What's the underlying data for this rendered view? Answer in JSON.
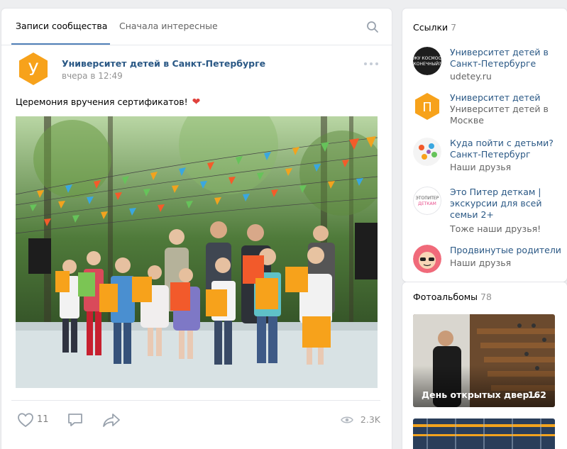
{
  "tabs": {
    "community_posts": "Записи сообщества",
    "interesting_first": "Сначала интересные"
  },
  "post": {
    "author": "Университет детей в Санкт-Петербурге",
    "time": "вчера в 12:49",
    "text": "Церемония вручения сертификатов!",
    "emoji": "❤",
    "avatar_letter": "У",
    "likes": "11",
    "views": "2.3K"
  },
  "links": {
    "title": "Ссылки",
    "count": "7",
    "items": [
      {
        "name": "Университет детей в Санкт-Петербурге",
        "desc": "udetey.ru",
        "avatar_text": "ЖУ КОСМОС КОНЕЧНЫЙ?"
      },
      {
        "name": "Университет детей",
        "desc": "Университет детей в Москве",
        "avatar_text": "П"
      },
      {
        "name": "Куда пойти с детьми? Санкт-Петербург",
        "desc": "Наши друзья",
        "avatar_text": ""
      },
      {
        "name": "Это Питер деткам | экскурсии для всей семьи 2+",
        "desc": "Тоже наши друзья!",
        "avatar_text": "ЭТОПИТЕР ДЕТКАМ"
      },
      {
        "name": "Продвинутые родители",
        "desc": "Наши друзья",
        "avatar_text": ""
      }
    ]
  },
  "albums": {
    "title": "Фотоальбомы",
    "count": "78",
    "items": [
      {
        "title": "День открытых двер...",
        "count": "162"
      }
    ]
  },
  "colors": {
    "accent": "#5181b8",
    "link": "#2a5885",
    "brand_orange": "#f7a21b"
  }
}
